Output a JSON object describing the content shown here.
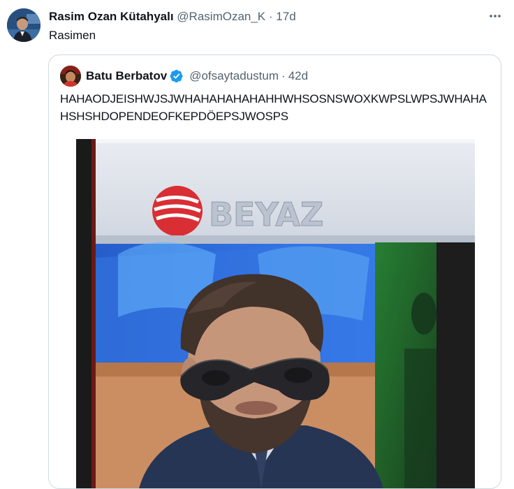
{
  "tweet": {
    "author_name": "Rasim Ozan Kütahyalı",
    "author_handle": "@RasimOzan_K",
    "separator": "·",
    "time": "17d",
    "text": "Rasimen",
    "more_icon": "more-horizontal-icon"
  },
  "quoted": {
    "author_name": "Batu Berbatov",
    "author_handle": "@ofsaytadustum",
    "separator": "·",
    "time": "42d",
    "verified_icon": "verified-badge-icon",
    "verified_color": "#1d9bf0",
    "text": "HAHAODJEISHWJSJWHAHAHAHAHAHHWHSOSNSWOXKWPSLWPSJWHAHAHSHSHDOPENDEOFKEPDÖEPSJWOSPS",
    "photo": {
      "channel_logo_text": "BEYAZ"
    }
  },
  "colors": {
    "text_primary": "#0f1419",
    "text_secondary": "#536471",
    "border": "#cfd9de"
  }
}
